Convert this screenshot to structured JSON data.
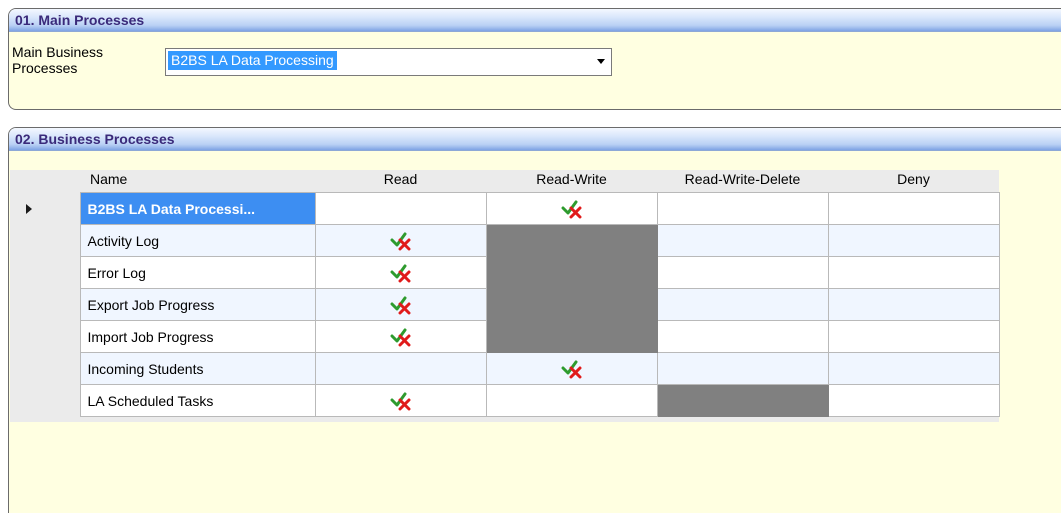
{
  "panel_main": {
    "title": "01. Main Processes",
    "label": "Main Business Processes",
    "selected": "B2BS LA Data Processing"
  },
  "panel_business": {
    "title": "02. Business Processes",
    "columns": [
      "Name",
      "Read",
      "Read-Write",
      "Read-Write-Delete",
      "Deny"
    ],
    "rows": [
      {
        "name": "B2BS LA Data Processi...",
        "permission": "Read-Write"
      },
      {
        "name": "Activity Log",
        "permission": "Read"
      },
      {
        "name": "Error Log",
        "permission": "Read"
      },
      {
        "name": "Export Job Progress",
        "permission": "Read"
      },
      {
        "name": "Import Job Progress",
        "permission": "Read"
      },
      {
        "name": "Incoming Students",
        "permission": "Read-Write"
      },
      {
        "name": "LA Scheduled Tasks",
        "permission": "Read"
      }
    ]
  },
  "icons": {
    "dropdown": "chevron-down-icon",
    "row_pointer": "row-pointer-icon",
    "permission_mark": "check-cross-icon"
  },
  "colors": {
    "panel_bg": "#ffffe1",
    "header_title": "#3a2a7a",
    "selection": "#3d8ef2",
    "disabled_cell": "#808080"
  }
}
